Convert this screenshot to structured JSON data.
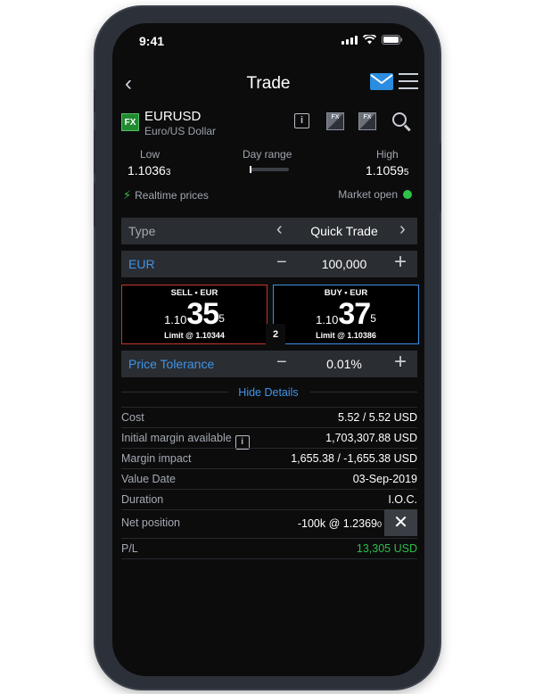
{
  "status": {
    "time": "9:41"
  },
  "nav": {
    "back": "‹",
    "title": "Trade"
  },
  "instrument": {
    "badge": "FX",
    "symbol": "EURUSD",
    "description": "Euro/US Dollar",
    "info_glyph": "i",
    "fx_glyph": "FX"
  },
  "range": {
    "low_label": "Low",
    "low_value": "1.1036",
    "low_sub": "3",
    "day_label": "Day range",
    "high_label": "High",
    "high_value": "1.1059",
    "high_sub": "5"
  },
  "realtime": {
    "label": "Realtime prices",
    "market": "Market open"
  },
  "type_row": {
    "label": "Type",
    "value": "Quick Trade",
    "prev": "‹",
    "next": "›"
  },
  "amount_row": {
    "label": "EUR",
    "value": "100,000",
    "minus": "−",
    "plus": "+"
  },
  "sell": {
    "head": "SELL • EUR",
    "small": "1.10",
    "big": "35",
    "sup": "5",
    "limit": "Limit @ 1.10344"
  },
  "buy": {
    "head": "BUY • EUR",
    "small": "1.10",
    "big": "37",
    "sup": "5",
    "limit": "Limit @ 1.10386"
  },
  "spread": "2",
  "tolerance_row": {
    "label": "Price Tolerance",
    "value": "0.01%",
    "minus": "−",
    "plus": "+"
  },
  "hide_details": "Hide Details",
  "details": {
    "cost_label": "Cost",
    "cost_value": "5.52 / 5.52 USD",
    "margin_label": "Initial margin available",
    "margin_value": "1,703,307.88 USD",
    "impact_label": "Margin impact",
    "impact_value": "1,655.38 / -1,655.38 USD",
    "date_label": "Value Date",
    "date_value": "03-Sep-2019",
    "duration_label": "Duration",
    "duration_value": "I.O.C.",
    "net_label": "Net position",
    "net_value": "-100k @ 1.2369",
    "net_sub": "0",
    "pl_label": "P/L",
    "pl_value": "13,305 USD"
  },
  "close_glyph": "✕",
  "colors": {
    "accent_blue": "#3f94e6",
    "green": "#2fbf47",
    "sell_red": "#c7342c",
    "buy_blue": "#3b8fe0"
  },
  "icons": [
    "back-icon",
    "mail-icon",
    "menu-icon",
    "info-icon",
    "fx-chart-icon",
    "search-icon",
    "bolt-icon",
    "close-icon"
  ]
}
